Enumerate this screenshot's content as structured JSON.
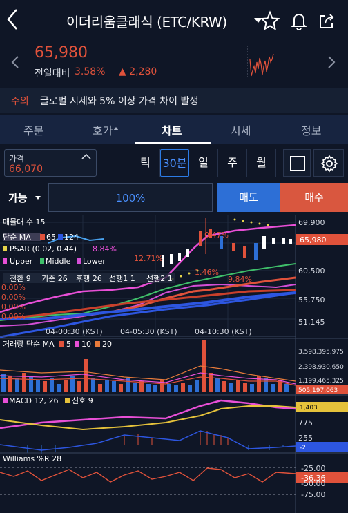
{
  "header": {
    "title": "이더리움클래식 (ETC/KRW)"
  },
  "ticker": {
    "price": "65,980",
    "prev_label": "전일대비",
    "change_pct": "3.58%",
    "change_abs": "▲ 2,280"
  },
  "notice": {
    "tag": "주의",
    "message": "글로벌 시세와 5% 이상 가격 차이 발생"
  },
  "tabs": [
    "주문",
    "호가",
    "차트",
    "시세",
    "정보"
  ],
  "price_box": {
    "label": "가격",
    "value": "66,070"
  },
  "periods": [
    "틱",
    "30분",
    "일",
    "주",
    "월"
  ],
  "order": {
    "avail": "가능",
    "percent": "100%",
    "sell": "매도",
    "buy": "매수"
  },
  "main_chart": {
    "legend_line1": "매물대 수 15",
    "ma_label": "단순 MA",
    "ma1": "65",
    "ma2": "124",
    "psar": "PSAR (0.02, 0.44)",
    "psar_pct": "8.84%",
    "bb_upper": "Upper",
    "bb_middle": "Middle",
    "bb_lower": "Lower",
    "ichimoku": "전환 9",
    "ichimoku2": "기준 26",
    "ichimoku3": "후행 26",
    "ichimoku4": "선행1 1",
    "ichimoku5": "선행2 1",
    "pct_a": "12.71%",
    "pct_b": "1.46%",
    "pct_c": "9.84%",
    "pct_d": "0.00%",
    "pct_top": "0.47%",
    "y_ticks": [
      "69,900",
      "60,500",
      "55,750",
      "51,145"
    ],
    "current": "65,980",
    "x_ticks": [
      "04-00:30 (KST)",
      "04-05:30 (KST)",
      "04-10:30 (KST)"
    ]
  },
  "volume_chart": {
    "title": "거래량 단순 MA",
    "ma1": "5",
    "ma2": "10",
    "ma3": "20",
    "y_ticks": [
      "3,598,395.975",
      "2,398,930.650",
      "1,199,465.325"
    ],
    "current": "505,197.063"
  },
  "macd_chart": {
    "title": "MACD 12, 26",
    "signal": "신호 9",
    "y_ticks": [
      "775",
      "255"
    ],
    "current_a": "1,403",
    "current_b": "-2"
  },
  "williams_chart": {
    "title": "Williams %R 28",
    "y_ticks": [
      "-25.00",
      "-50.00",
      "-75.00"
    ],
    "current": "-36.36"
  },
  "colors": {
    "up": "#e0523b",
    "down": "#2d6fd6",
    "bg": "#0f1626",
    "accent": "#4a90ff"
  }
}
